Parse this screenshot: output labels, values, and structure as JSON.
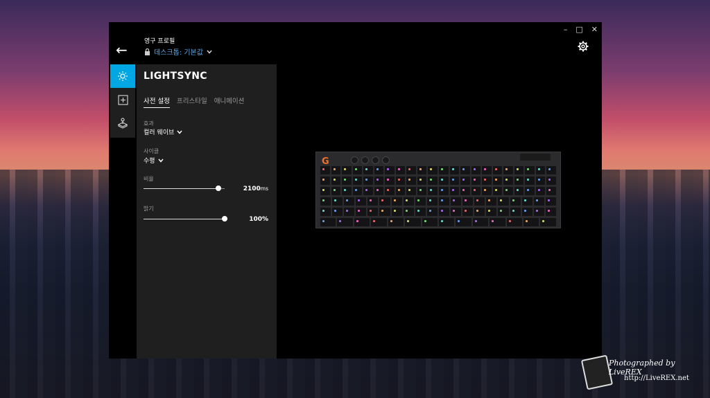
{
  "window": {
    "controls": {
      "minimize": "–",
      "maximize": "□",
      "close": "✕"
    },
    "back_label": "←"
  },
  "profile": {
    "heading": "영구 프로필",
    "value_prefix": "데스크톱",
    "value_suffix": ": 기본값"
  },
  "sidebar": {
    "items": [
      {
        "icon": "lightsync-icon",
        "active": true
      },
      {
        "icon": "assignments-icon",
        "active": false
      },
      {
        "icon": "game-mode-icon",
        "active": false
      }
    ]
  },
  "panel": {
    "title": "LIGHTSYNC",
    "tabs": [
      {
        "label": "사전 설정",
        "active": true
      },
      {
        "label": "프리스타일",
        "active": false
      },
      {
        "label": "애니메이션",
        "active": false
      }
    ],
    "effect": {
      "label": "효과",
      "value": "컬러 웨이브"
    },
    "direction": {
      "label": "사이클",
      "value": "수평"
    },
    "rate": {
      "label": "비율",
      "value": "2100",
      "unit": "ms",
      "fraction": 0.92
    },
    "brightness": {
      "label": "밝기",
      "value": "100%",
      "fraction": 1.0
    }
  },
  "keyboard": {
    "logo": "G"
  },
  "watermark": {
    "line1": "Photographed by LiveREX",
    "line2": "http://LiveREX.net"
  },
  "colors": {
    "accent": "#00a7e3",
    "panel": "#1f1f1f",
    "window": "#000000"
  }
}
